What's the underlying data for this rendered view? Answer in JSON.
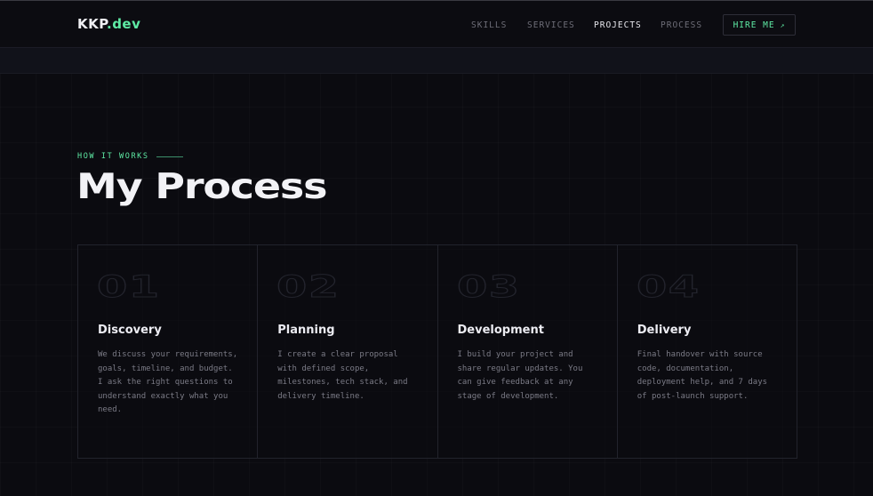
{
  "nav": {
    "logo_main": "KKP",
    "logo_accent": ".dev",
    "links": [
      "SKILLS",
      "SERVICES",
      "PROJECTS",
      "PROCESS"
    ],
    "active_link": "PROJECTS",
    "cta_label": "HIRE ME",
    "cta_arrow": "↗"
  },
  "section": {
    "eyebrow": "HOW IT WORKS",
    "title": "My Process"
  },
  "steps": [
    {
      "number": "01",
      "title": "Discovery",
      "description": "We discuss your requirements, goals, timeline, and budget. I ask the right questions to understand exactly what you need."
    },
    {
      "number": "02",
      "title": "Planning",
      "description": "I create a clear proposal with defined scope, milestones, tech stack, and delivery timeline."
    },
    {
      "number": "03",
      "title": "Development",
      "description": "I build your project and share regular updates. You can give feedback at any stage of development."
    },
    {
      "number": "04",
      "title": "Delivery",
      "description": "Final handover with source code, documentation, deployment help, and 7 days of post-launch support."
    }
  ],
  "colors": {
    "accent": "#5eeaa4",
    "background": "#0b0b10",
    "text_primary": "#f2f2f6",
    "text_muted": "#7b7b86"
  }
}
